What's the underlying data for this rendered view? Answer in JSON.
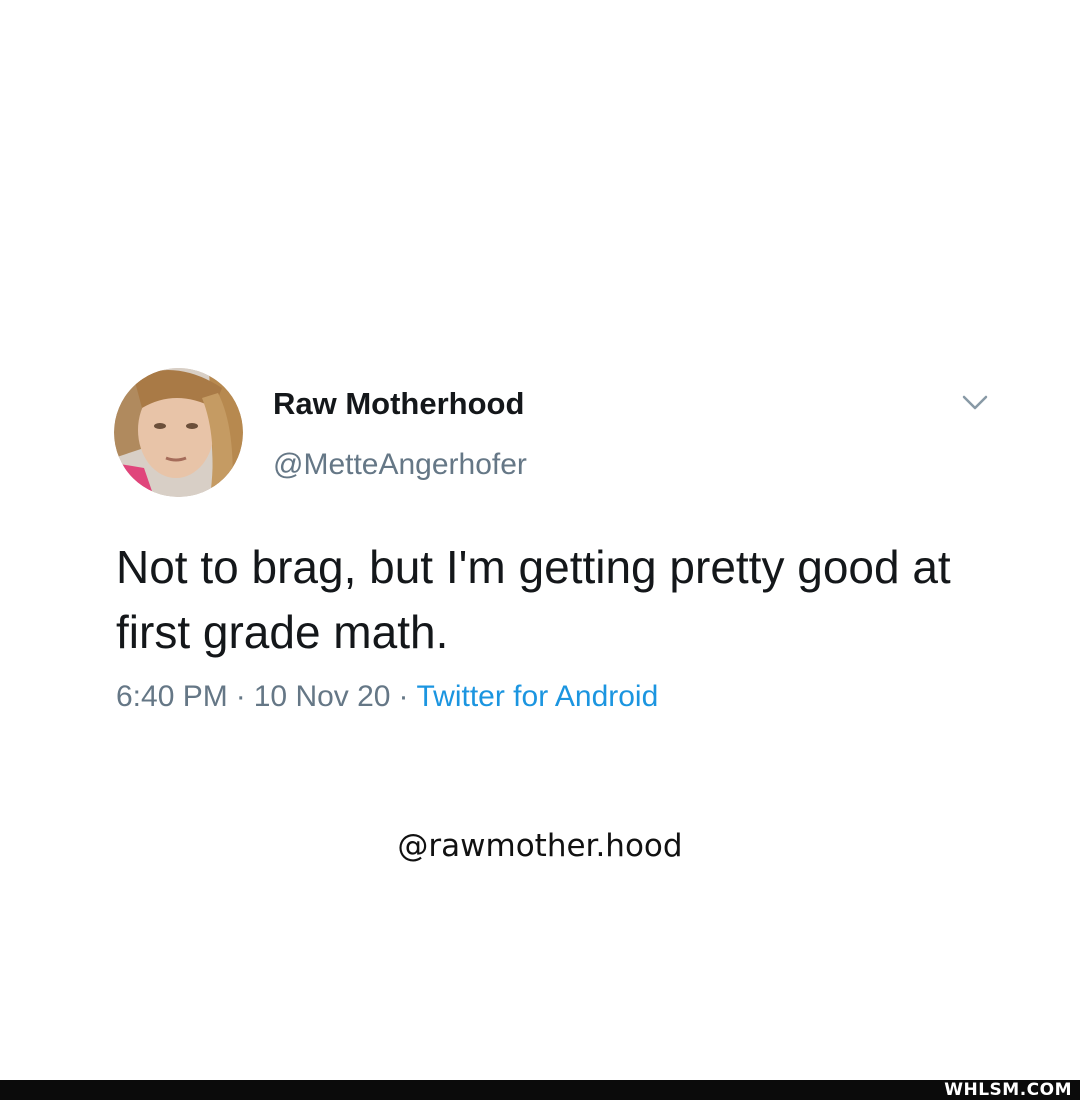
{
  "tweet": {
    "display_name": "Raw Motherhood",
    "handle": "@MetteAngerhofer",
    "text": "Not to brag, but I'm getting pretty good at first grade math.",
    "time": "6:40 PM",
    "date": "10 Nov 20",
    "separator": "·",
    "source": "Twitter for Android",
    "avatar_icon": "avatar-photo",
    "menu_icon": "chevron-down-icon"
  },
  "watermark": {
    "handle": "@rawmother.hood"
  },
  "footer": {
    "brand": "WHLSM.COM"
  },
  "colors": {
    "text": "#14171a",
    "secondary_text": "#657786",
    "link": "#1b95e0",
    "footer_bg": "#0b0b0b"
  }
}
